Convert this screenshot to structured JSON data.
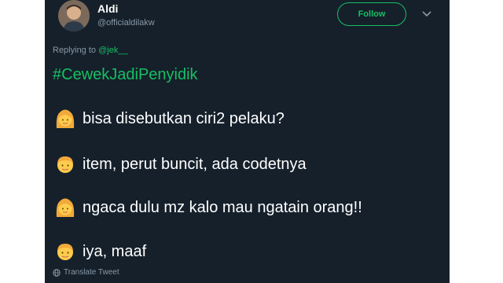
{
  "user": {
    "display_name": "Aldi",
    "handle": "@officialdilakw"
  },
  "follow_button": {
    "label": "Follow"
  },
  "reply": {
    "prefix": "Replying to",
    "mention": "@jek__"
  },
  "tweet": {
    "hashtag": "#CewekJadiPenyidik",
    "lines": [
      {
        "speaker_icon": "woman-face-icon",
        "text": "bisa disebutkan ciri2 pelaku?"
      },
      {
        "speaker_icon": "man-face-icon",
        "text": "item, perut buncit, ada codetnya"
      },
      {
        "speaker_icon": "woman-face-icon",
        "text": "ngaca dulu mz kalo mau ngatain orang!!"
      },
      {
        "speaker_icon": "man-face-icon",
        "text": "iya, maaf"
      }
    ]
  },
  "footer": {
    "translate_label": "Translate Tweet"
  },
  "colors": {
    "background": "#15202b",
    "accent": "#17bf63",
    "secondary_text": "#8899a6",
    "primary_text": "#ffffff"
  }
}
